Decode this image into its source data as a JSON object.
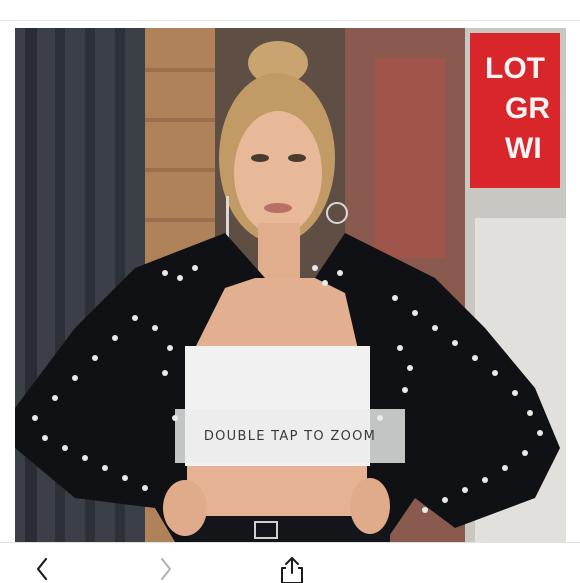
{
  "viewer": {
    "zoom_hint": "DOUBLE TAP TO ZOOM"
  },
  "photo": {
    "description_icon": "product-photo",
    "sign_text": "LOT\nGR\nWI"
  },
  "toolbar": {
    "back_icon": "chevron-left-icon",
    "forward_icon": "chevron-right-icon",
    "share_icon": "share-icon",
    "forward_enabled": false
  },
  "colors": {
    "icon_active": "#1c1c1c",
    "icon_disabled": "#b5b5b5",
    "hint_background": "#ebebeb",
    "hint_text": "#3a3a3a"
  }
}
